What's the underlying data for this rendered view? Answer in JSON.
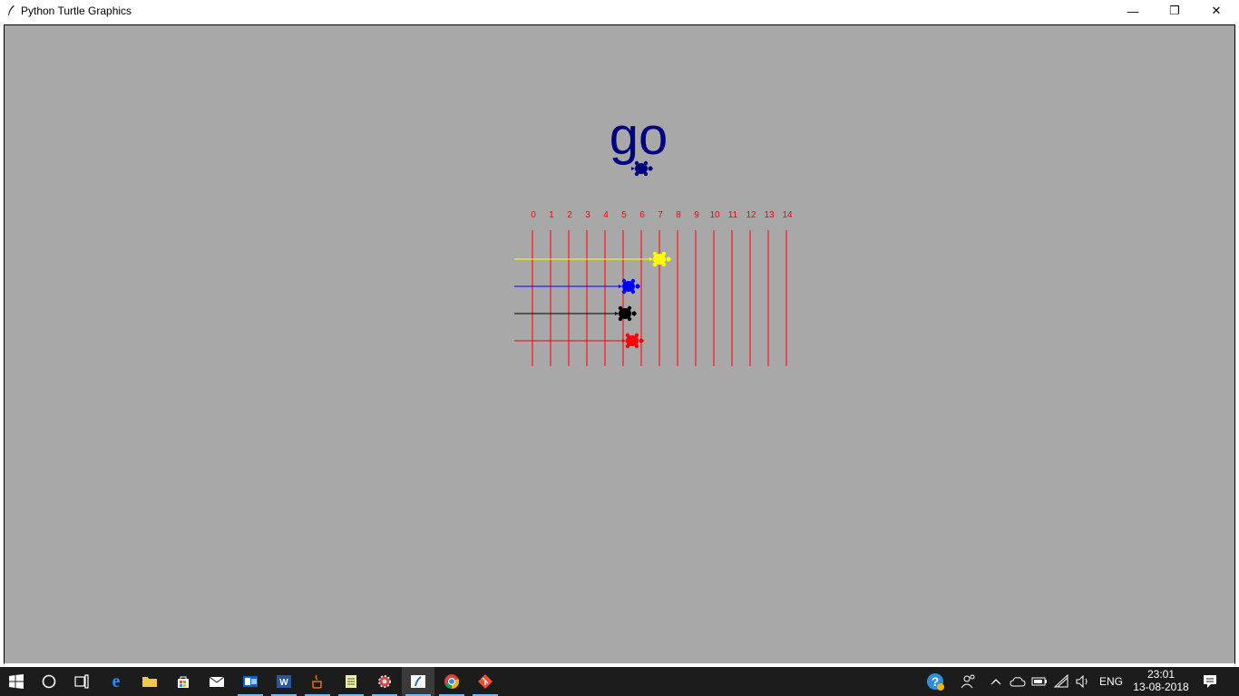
{
  "window": {
    "title": "Python Turtle Graphics",
    "minimize_glyph": "—",
    "maximize_glyph": "❐",
    "close_glyph": "✕"
  },
  "canvas": {
    "background": "#a8a8a8",
    "heading_text": "go",
    "heading_color": "#000080",
    "track_color": "#ff0000",
    "track_numbers": [
      "0",
      "1",
      "2",
      "3",
      "4",
      "5",
      "6",
      "7",
      "8",
      "9",
      "10",
      "11",
      "12",
      "13",
      "14"
    ],
    "racers": [
      {
        "name": "yellow-turtle",
        "color": "#ffff00",
        "position": 7
      },
      {
        "name": "blue-turtle",
        "color": "#0000ff",
        "position": 5.3
      },
      {
        "name": "black-turtle",
        "color": "#000000",
        "position": 5.1
      },
      {
        "name": "red-turtle",
        "color": "#ff0000",
        "position": 5.5
      }
    ]
  },
  "taskbar": {
    "background": "#1c1c1c",
    "items": [
      {
        "name": "start-button",
        "icon": "windows-logo"
      },
      {
        "name": "search-button",
        "icon": "cortana-circle"
      },
      {
        "name": "task-view-button",
        "icon": "task-view"
      },
      {
        "name": "edge-button",
        "icon": "edge-e"
      },
      {
        "name": "file-explorer-button",
        "icon": "folder"
      },
      {
        "name": "store-button",
        "icon": "shopping-bag"
      },
      {
        "name": "mail-button",
        "icon": "envelope"
      },
      {
        "name": "outlook-button",
        "icon": "outlook"
      },
      {
        "name": "word-button",
        "icon": "word"
      },
      {
        "name": "java-button",
        "icon": "java-cup"
      },
      {
        "name": "notepad-button",
        "icon": "notepad"
      },
      {
        "name": "settings-app-button",
        "icon": "gear"
      },
      {
        "name": "python-button",
        "icon": "python-feather"
      },
      {
        "name": "chrome-button",
        "icon": "chrome"
      },
      {
        "name": "git-button",
        "icon": "git-diamond"
      }
    ],
    "tray": {
      "language": "ENG",
      "time": "23:01",
      "date": "13-08-2018"
    }
  }
}
